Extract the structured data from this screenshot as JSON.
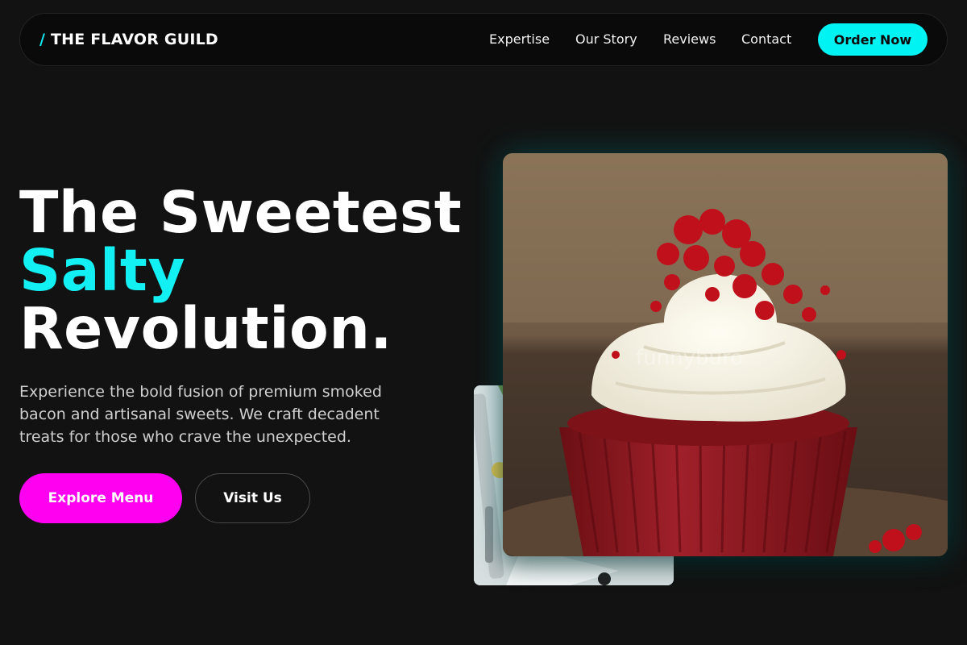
{
  "brand": {
    "slash": "/",
    "name": "THE FLAVOR GUILD"
  },
  "nav": {
    "links": [
      "Expertise",
      "Our Story",
      "Reviews",
      "Contact"
    ],
    "cta": "Order Now"
  },
  "hero": {
    "headline_line1": "The Sweetest",
    "headline_accent": "Salty",
    "headline_line3": "Revolution.",
    "subcopy": "Experience the bold fusion of premium smoked bacon and artisanal sweets. We craft decadent treats for those who crave the unexpected.",
    "primary_button": "Explore Menu",
    "secondary_button": "Visit Us"
  },
  "images": {
    "main": {
      "watermark": "funnyburo"
    }
  },
  "colors": {
    "accent_cyan": "#00f3f3",
    "accent_magenta": "#ff00f0",
    "background": "#121212"
  }
}
